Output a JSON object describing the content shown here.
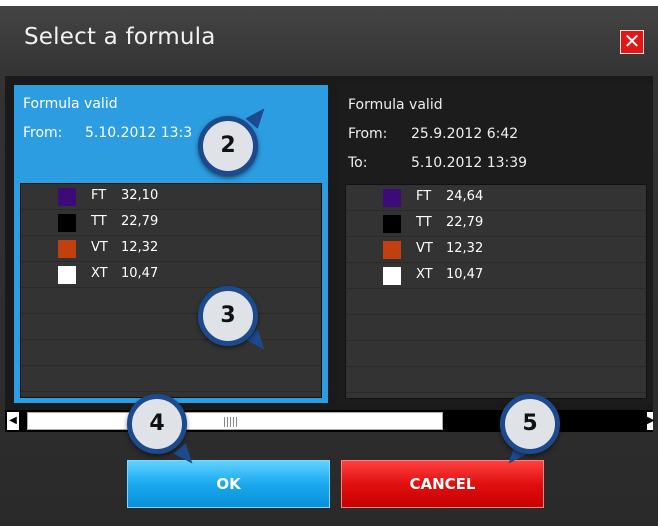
{
  "dialog": {
    "title": "Select a formula",
    "close_glyph": "✕"
  },
  "panels": [
    {
      "status": "Formula valid",
      "from_label": "From:",
      "from_value": "5.10.2012 13:3",
      "rows": [
        {
          "code": "FT",
          "value": "32,10",
          "color": "#3d0a7a"
        },
        {
          "code": "TT",
          "value": "22,79",
          "color": "#000000"
        },
        {
          "code": "VT",
          "value": "12,32",
          "color": "#c04010"
        },
        {
          "code": "XT",
          "value": "10,47",
          "color": "#ffffff"
        }
      ]
    },
    {
      "status": "Formula valid",
      "from_label": "From:",
      "from_value": "25.9.2012 6:42",
      "to_label": "To:",
      "to_value": "5.10.2012 13:39",
      "rows": [
        {
          "code": "FT",
          "value": "24,64",
          "color": "#3d0a7a"
        },
        {
          "code": "TT",
          "value": "22,79",
          "color": "#000000"
        },
        {
          "code": "VT",
          "value": "12,32",
          "color": "#c04010"
        },
        {
          "code": "XT",
          "value": "10,47",
          "color": "#ffffff"
        }
      ]
    }
  ],
  "buttons": {
    "ok": "OK",
    "cancel": "CANCEL"
  },
  "callouts": {
    "c2": "2",
    "c3": "3",
    "c4": "4",
    "c5": "5"
  },
  "colors": {
    "selected_panel": "#2b9de0",
    "ok_button": "#1aa8ee",
    "cancel_button": "#e01010",
    "close_button": "#e01818"
  }
}
